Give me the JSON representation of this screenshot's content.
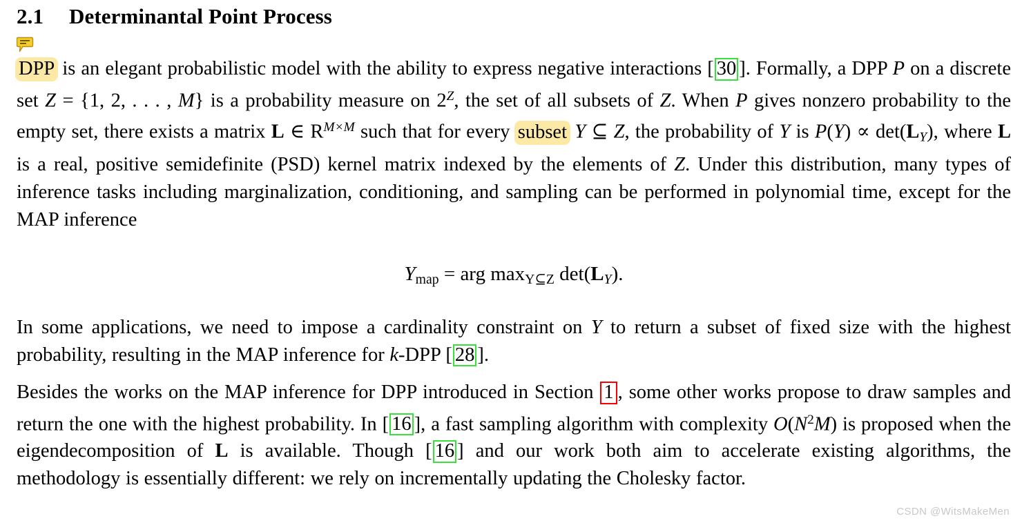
{
  "document": {
    "section_number": "2.1",
    "section_title": "Determinantal Point Process",
    "watermark": "CSDN @WitsMakeMen"
  },
  "annotations": {
    "comment_icon_name": "comment-note-icon",
    "highlight_color": "#fce9a6",
    "link_box_green": "#3ae03a",
    "link_box_red": "#fa0000",
    "highlighted_terms": [
      "DPP",
      "subset"
    ]
  },
  "paragraph1": {
    "t01": "DPP",
    "t02": " is an elegant probabilistic model with the ability to express negative interactions [",
    "cite_30": "30",
    "t03": "]. Formally, a DPP ",
    "m_P1": "P",
    "t04": " on a discrete set ",
    "m_Z1": "Z",
    "t05": " = {1, 2, . . . , ",
    "m_M1": "M",
    "t06": "} is a probability measure on 2",
    "m_Zsup": "Z",
    "t07": ", the set of all subsets of ",
    "m_Z2": "Z",
    "t08": ". When ",
    "m_P2": "P",
    "t09": " gives nonzero probability to the empty set, there exists a matrix ",
    "m_L1": "L",
    "t10": " ∈ ",
    "m_R": "R",
    "m_MxM": "M×M",
    "t11": " such that for every ",
    "t12": "subset",
    "t13": " ",
    "m_Y1": "Y",
    "t14": " ⊆ ",
    "m_Z3": "Z",
    "t15": ", the probability of ",
    "m_Y2": "Y",
    "t16": " is ",
    "m_P3": "P",
    "t17": "(",
    "m_Y3": "Y",
    "t18": ") ∝ det(",
    "m_L2": "L",
    "m_Ysub": "Y",
    "t19": "), where ",
    "m_L3": "L",
    "t20": " is a real, positive semidefinite (PSD) kernel matrix indexed by the elements of ",
    "m_Z4": "Z",
    "t21": ".  Under this distribution, many types of inference tasks including marginalization, conditioning, and sampling can be performed in polynomial time, except for the MAP inference"
  },
  "equation": {
    "lhs_var": "Y",
    "lhs_sub": "map",
    "eq": " = ",
    "argmax": "arg max",
    "argmax_sub": "Y⊆Z",
    "det": " det(",
    "matrix": "L",
    "matrix_sub": "Y",
    "close": ")."
  },
  "paragraph2": {
    "t01": "In some applications, we need to impose a cardinality constraint on ",
    "m_Y": "Y",
    "t02": " to return a subset of fixed size with the highest probability, resulting in the MAP inference for ",
    "m_k": "k",
    "t03": "-DPP [",
    "cite_28": "28",
    "t04": "]."
  },
  "paragraph3": {
    "t01": "Besides the works on the MAP inference for DPP introduced in Section ",
    "link_sec1": "1",
    "t02": ", some other works propose to draw samples and return the one with the highest probability. In [",
    "cite_16a": "16",
    "t03": "], a fast sampling algorithm with complexity ",
    "m_O": "O",
    "t04": "(",
    "m_N": "N",
    "m_Nsup": "2",
    "m_M": "M",
    "t05": ") is proposed when the eigendecomposition of ",
    "m_L": "L",
    "t06": " is available. Though [",
    "cite_16b": "16",
    "t07": "] and our work both aim to accelerate existing algorithms, the methodology is essentially different: we rely on incrementally updating the Cholesky factor."
  }
}
